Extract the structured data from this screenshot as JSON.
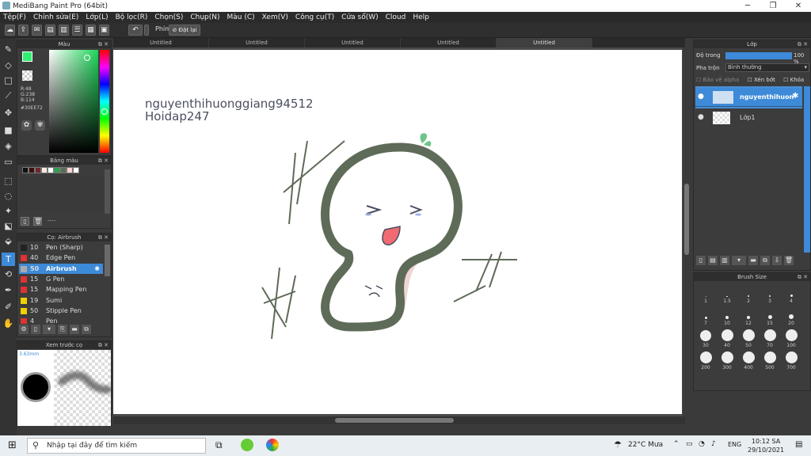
{
  "window": {
    "title": "MediBang Paint Pro (64bit)"
  },
  "menu": [
    "Tệp(F)",
    "Chỉnh sửa(E)",
    "Lớp(L)",
    "Bộ lọc(R)",
    "Chọn(S)",
    "Chụp(N)",
    "Màu (C)",
    "Xem(V)",
    "Công cụ(T)",
    "Cửa sổ(W)",
    "Cloud",
    "Help"
  ],
  "toolbar": {
    "keys_label": "Phím",
    "reset_label": "Đặt lại"
  },
  "tabs": [
    "Untitled",
    "Untitled",
    "Untitled",
    "Untitled",
    "Untitled"
  ],
  "color_panel": {
    "title": "Màu",
    "r": "R:48",
    "g": "G:238",
    "b": "B:114",
    "hex": "#30EE72",
    "fg_color": "#30EE72"
  },
  "palette": {
    "title": "Bảng màu",
    "empty_label": "----",
    "swatches": [
      "#111111",
      "#3a1010",
      "#6a2a2a",
      "#ffe9e0",
      "#ffffff",
      "#2aa14a",
      "#5a6b58",
      "#ffd0d0",
      "#ffffff"
    ]
  },
  "brush_panel": {
    "title": "Cọ: Airbrush",
    "items": [
      {
        "size": "10",
        "name": "Pen (Sharp)",
        "color": "#222222"
      },
      {
        "size": "40",
        "name": "Edge Pen",
        "color": "#dd3333"
      },
      {
        "size": "50",
        "name": "Airbrush",
        "color": "#aaaaaa"
      },
      {
        "size": "15",
        "name": "G Pen",
        "color": "#dd3333"
      },
      {
        "size": "15",
        "name": "Mapping Pen",
        "color": "#dd3333"
      },
      {
        "size": "19",
        "name": "Sumi",
        "color": "#f0d000"
      },
      {
        "size": "50",
        "name": "Stipple Pen",
        "color": "#f0d000"
      },
      {
        "size": "4",
        "name": "Pen",
        "color": "#dd3333"
      }
    ]
  },
  "preview_panel": {
    "title": "Xem trước cọ",
    "size": "3.63mm"
  },
  "watermark": {
    "line1": "nguyenthihuonggiang94512",
    "line2": "Hoidap247"
  },
  "layer_panel": {
    "title": "Lớp",
    "opacity_label": "Độ trong",
    "opacity_value": "100 %",
    "opacity": 1.0,
    "blend_label": "Pha trộn",
    "blend_value": "Bình thường",
    "protect_alpha": "Bảo vệ alpha",
    "clipping": "Xén bớt",
    "lock": "Khóa",
    "layers": [
      {
        "name": "nguyenthihuon",
        "selected": true
      },
      {
        "name": "Lớp1",
        "selected": false
      }
    ]
  },
  "brush_size_panel": {
    "title": "Brush Size",
    "sizes": [
      "1",
      "1.5",
      "2",
      "3",
      "4",
      "7",
      "10",
      "12",
      "15",
      "20",
      "30",
      "40",
      "50",
      "70",
      "100",
      "200",
      "300",
      "400",
      "500",
      "700"
    ]
  },
  "taskbar": {
    "search_placeholder": "Nhập tại đây để tìm kiếm",
    "weather": "22°C  Mưa",
    "lang": "ENG",
    "time": "10:12 SA",
    "date": "29/10/2021"
  },
  "colors": {
    "accent": "#3d8ad8",
    "stroke": "#5e6b58",
    "blush": "#f0d4d4",
    "mouth": "#f06b72",
    "sprout": "#6fc48a"
  }
}
